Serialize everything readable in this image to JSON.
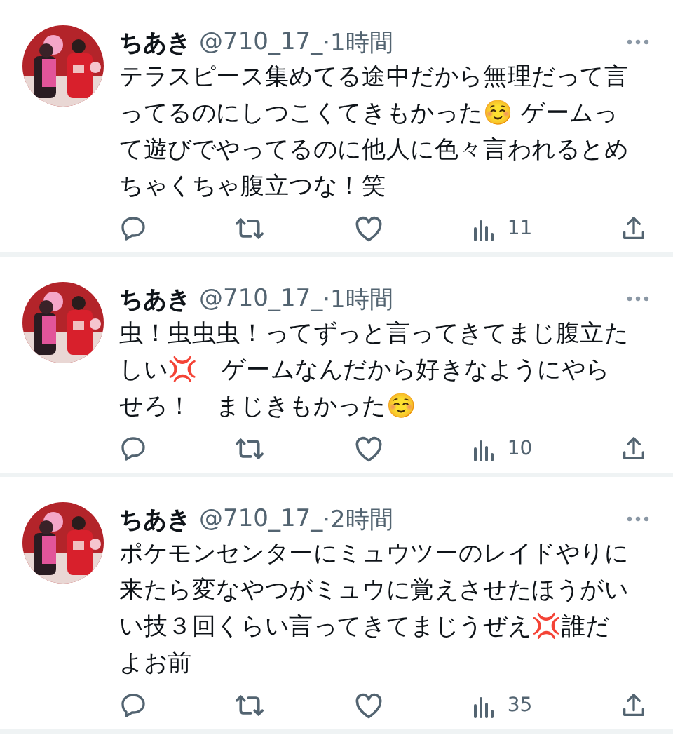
{
  "tweets": [
    {
      "name": "ちあき",
      "handle": "@710_17_",
      "time": "·1時間",
      "lines": [
        "テラスピース集めてる途中だから無理だって言",
        "ってるのにしつこくてきもかった☺️ ゲームっ",
        "て遊びでやってるのに他人に色々言われるとめ",
        "ちゃくちゃ腹立つな！笑"
      ],
      "views": "11"
    },
    {
      "name": "ちあき",
      "handle": "@710_17_",
      "time": "·1時間",
      "lines": [
        "虫！虫虫虫！ってずっと言ってきてまじ腹立た",
        "しい💢　ゲームなんだから好きなようにやら",
        "せろ！　まじきもかった☺️"
      ],
      "views": "10"
    },
    {
      "name": "ちあき",
      "handle": "@710_17_",
      "time": "·2時間",
      "lines": [
        "ポケモンセンターにミュウツーのレイドやりに",
        "来たら変なやつがミュウに覚えさせたほうがい",
        "い技３回くらい言ってきてまじうぜえ💢誰だ",
        "よお前"
      ],
      "views": "35"
    }
  ]
}
